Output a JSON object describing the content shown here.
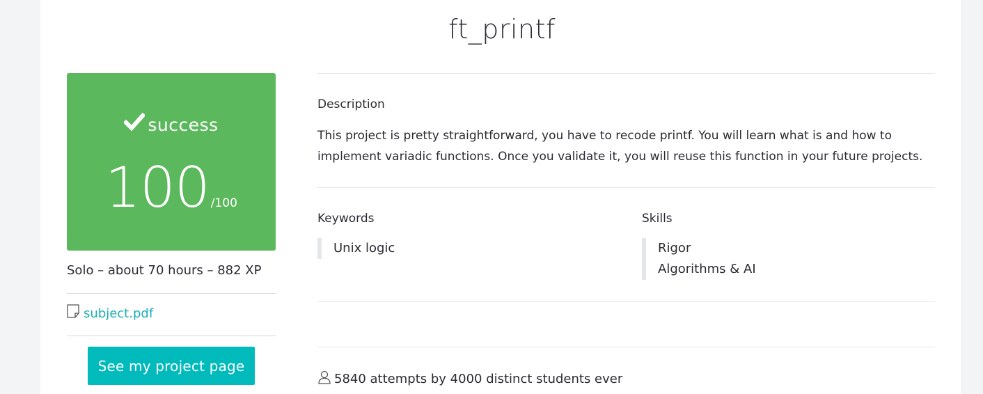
{
  "project": {
    "title": "ft_printf"
  },
  "status": {
    "label": "success",
    "score": "100",
    "max": "/100",
    "color": "#5cb85c"
  },
  "meta": {
    "text": "Solo – about 70 hours – 882 XP"
  },
  "file": {
    "icon": "file-icon",
    "name": "subject.pdf"
  },
  "project_button": {
    "label": "See my project page",
    "color": "#00babc"
  },
  "description": {
    "label": "Description",
    "text": "This project is pretty straightforward, you have to recode printf. You will learn what is and how to implement variadic functions. Once you validate it, you will reuse this function in your future projects."
  },
  "keywords": {
    "label": "Keywords",
    "items": [
      "Unix logic"
    ]
  },
  "skills": {
    "label": "Skills",
    "items": [
      "Rigor",
      "Algorithms & AI"
    ]
  },
  "stats": {
    "icon": "user-icon",
    "text": "5840 attempts by 4000 distinct students ever"
  }
}
